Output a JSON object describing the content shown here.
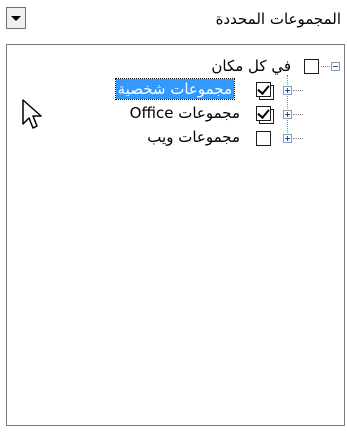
{
  "header": {
    "title": "المجموعات المحددة"
  },
  "tree": {
    "root": {
      "label": "في كل مكان",
      "checked": false,
      "expanded": true
    },
    "children": [
      {
        "label": "مجموعات شخصية",
        "checked": true,
        "selected": true,
        "expanded": false
      },
      {
        "label": "مجموعات Office",
        "checked": true,
        "selected": false,
        "expanded": false
      },
      {
        "label": "مجموعات ويب",
        "checked": false,
        "selected": false,
        "expanded": false
      }
    ]
  }
}
